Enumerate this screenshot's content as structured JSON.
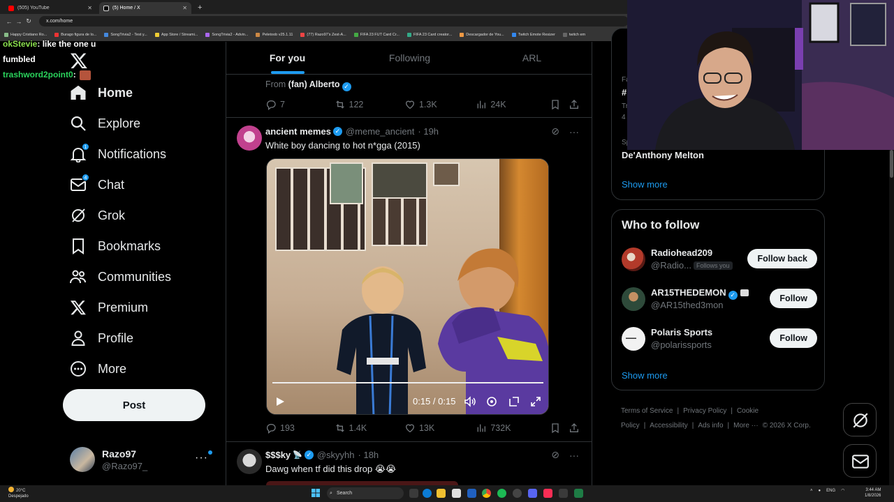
{
  "browser": {
    "tabs": [
      {
        "title": "(505) YouTube",
        "favicon": "youtube-icon",
        "active": false
      },
      {
        "title": "(5) Home / X",
        "favicon": "x-icon",
        "active": true
      }
    ],
    "url": "x.com/home",
    "bookmarks": [
      "Happy Cristiano Ro...",
      "Burago figura de lo...",
      "SongTrivia2 - Test y...",
      "App Store / Streami...",
      "SongTrivia2 - Advin...",
      "Peletoob v25.1.11",
      "(77) Razo97's Zest-A...",
      "FIFA 23 FUT Card Cr...",
      "FIFA 23 Card creator...",
      "Descargador de You...",
      "Twitch Emote Resizer",
      "twitch em"
    ]
  },
  "chat_overlay": {
    "lines": [
      {
        "user": "okStevie",
        "text": ": like the one u"
      },
      {
        "user": "",
        "text": "fumbled"
      },
      {
        "user": "trashword2point0",
        "text": ":"
      }
    ]
  },
  "nav": {
    "items": [
      {
        "label": "Home",
        "icon": "home-icon"
      },
      {
        "label": "Explore",
        "icon": "search-icon"
      },
      {
        "label": "Notifications",
        "icon": "bell-icon",
        "badge": "1"
      },
      {
        "label": "Chat",
        "icon": "mail-icon",
        "badge": "4"
      },
      {
        "label": "Grok",
        "icon": "grok-icon"
      },
      {
        "label": "Bookmarks",
        "icon": "bookmark-icon"
      },
      {
        "label": "Communities",
        "icon": "communities-icon"
      },
      {
        "label": "Premium",
        "icon": "x-icon"
      },
      {
        "label": "Profile",
        "icon": "person-icon"
      },
      {
        "label": "More",
        "icon": "more-circle-icon"
      }
    ],
    "post_label": "Post",
    "account": {
      "name": "Razo97",
      "handle": "@Razo97_",
      "more": "···"
    }
  },
  "feed": {
    "tabs": [
      "For you",
      "Following",
      "ARL"
    ],
    "prev_tweet": {
      "from_prefix": "From",
      "from_name": "(fan) Alberto",
      "replies": "7",
      "reposts": "122",
      "likes": "1.3K",
      "views": "24K"
    },
    "tweet1": {
      "name": "ancient memes",
      "handle": "@meme_ancient",
      "time": "· 19h",
      "text": "White boy dancing to hot n*gga (2015)",
      "video_time": "0:15 / 0:15",
      "video_progress": 1.0,
      "replies": "193",
      "reposts": "1.4K",
      "likes": "13K",
      "views": "732K"
    },
    "tweet2": {
      "name": "$$$ky",
      "handle": "@skyyhh",
      "time": "· 18h",
      "text": "Dawg when tf did this drop 😭😭"
    }
  },
  "sidebar": {
    "trends": {
      "frag1": "Fa",
      "frag2": "#",
      "frag3": "Tr",
      "frag4": "4",
      "frag5": "Sp",
      "trend_name": "De'Anthony Melton",
      "show_more": "Show more"
    },
    "who_to_follow": {
      "title": "Who to follow",
      "accounts": [
        {
          "name": "Radiohead209",
          "handle": "@Radio...",
          "follows_you": "Follows you",
          "button": "Follow back"
        },
        {
          "name": "AR15THEDEMON",
          "handle": "@AR15thed3mon",
          "follows_you": "",
          "button": "Follow"
        },
        {
          "name": "Polaris Sports",
          "handle": "@polarissports",
          "follows_you": "",
          "button": "Follow"
        }
      ],
      "show_more": "Show more"
    },
    "footer": [
      "Terms of Service",
      "|",
      "Privacy Policy",
      "|",
      "Cookie Policy",
      "|",
      "Accessibility",
      "|",
      "Ads info",
      "|",
      "More ···",
      "© 2026 X Corp."
    ]
  },
  "taskbar": {
    "weather_temp": "20°C",
    "weather_desc": "Despejado",
    "search": "Search",
    "lang": "ENG",
    "time": "3:44 AM",
    "date": "1/8/2026"
  },
  "colors": {
    "accent": "#1d9bf0",
    "background": "#000000",
    "text": "#e7e9ea",
    "muted": "#71767b",
    "border": "#2f3336"
  }
}
